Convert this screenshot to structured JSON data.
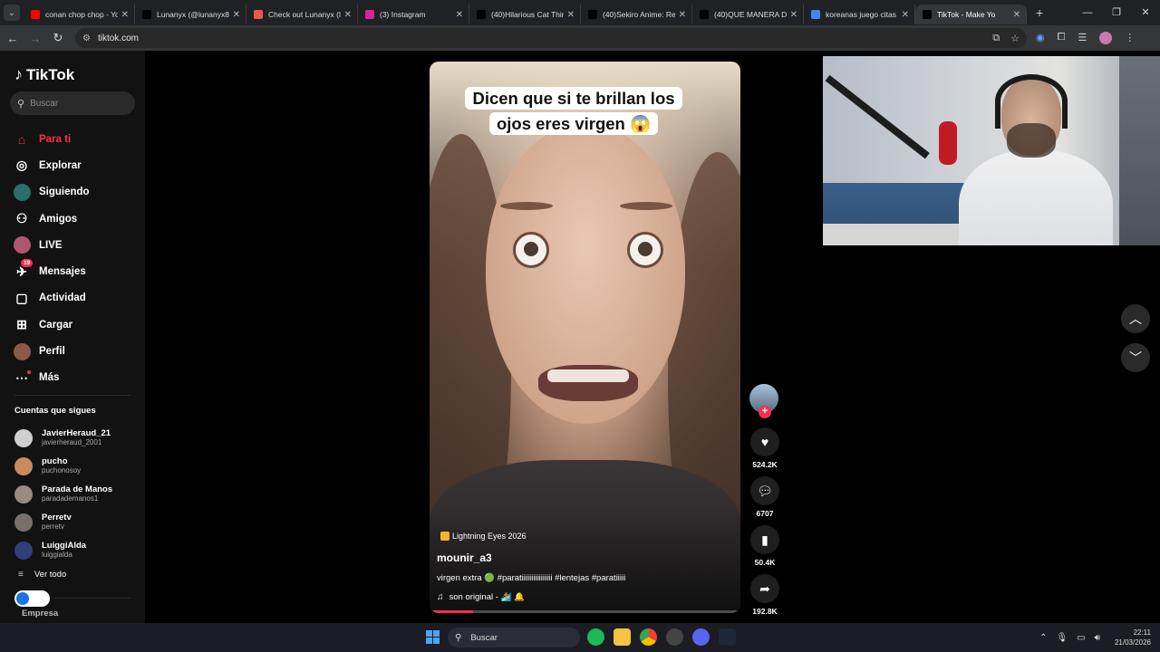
{
  "browser": {
    "tabs": [
      {
        "title": "conan chop chop - Yo",
        "favicon_color": "#ff0000",
        "favicon": "yt-icon",
        "active": false
      },
      {
        "title": "Lunanyx (@lunanyx8",
        "favicon_color": "#000000",
        "favicon": "tiktok-icon",
        "active": false
      },
      {
        "title": "Check out Lunanyx (l",
        "favicon_color": "#e8594a",
        "favicon": "page-icon",
        "active": false
      },
      {
        "title": "(3) Instagram",
        "favicon_color": "#d6249f",
        "favicon": "instagram-icon",
        "active": false
      },
      {
        "title": "(40)Hilarious Cat Thin",
        "favicon_color": "#000000",
        "favicon": "tiktok-icon",
        "active": false
      },
      {
        "title": "(40)Sekiro Anime: Re",
        "favicon_color": "#000000",
        "favicon": "tiktok-icon",
        "active": false
      },
      {
        "title": "(40)QUE MANERA DE",
        "favicon_color": "#000000",
        "favicon": "tiktok-icon",
        "active": false
      },
      {
        "title": "koreanas juego citas",
        "favicon_color": "#4285f4",
        "favicon": "google-icon",
        "active": false
      },
      {
        "title": "TikTok - Make Yo",
        "favicon_color": "#000000",
        "favicon": "tiktok-icon",
        "active": true
      }
    ],
    "url": "tiktok.com"
  },
  "sidebar": {
    "logo": "TikTok",
    "search_placeholder": "Buscar",
    "nav": [
      {
        "label": "Para ti",
        "icon": "home-icon",
        "active": true
      },
      {
        "label": "Explorar",
        "icon": "compass-icon",
        "active": false
      },
      {
        "label": "Siguiendo",
        "icon": "following-avatar-icon",
        "active": false
      },
      {
        "label": "Amigos",
        "icon": "friends-icon",
        "active": false
      },
      {
        "label": "LIVE",
        "icon": "live-avatar-icon",
        "active": false
      },
      {
        "label": "Mensajes",
        "icon": "messages-icon",
        "active": false,
        "badge": "19"
      },
      {
        "label": "Actividad",
        "icon": "activity-icon",
        "active": false
      },
      {
        "label": "Cargar",
        "icon": "upload-icon",
        "active": false
      },
      {
        "label": "Perfil",
        "icon": "profile-avatar-icon",
        "active": false
      },
      {
        "label": "Más",
        "icon": "more-icon",
        "active": false
      }
    ],
    "following_title": "Cuentas que sigues",
    "following": [
      {
        "name": "JavierHeraud_21",
        "handle": "javierheraud_2001",
        "color": "#cfcfcf"
      },
      {
        "name": "pucho",
        "handle": "puchonosoy",
        "color": "#c98a5e"
      },
      {
        "name": "Parada de Manos",
        "handle": "paradademanos1",
        "color": "#9a8a80"
      },
      {
        "name": "Perretv",
        "handle": "perretv",
        "color": "#7a6f6a"
      },
      {
        "name": "LuiggiAlda",
        "handle": "luiggialda",
        "color": "#2f3f7a"
      }
    ],
    "see_all": "Ver todo",
    "empresa": "Empresa"
  },
  "video": {
    "caption_text": "Dicen que si te brillan los ojos eres virgen 😱",
    "effect": "Lightning Eyes 2026",
    "author": "mounir_a3",
    "description": "virgen extra 🟢 #paratiiiiiiiiiiiiiiii #lentejas #paratiiiii",
    "sound": "son original - 🏄 🔔",
    "progress_fraction": 0.14
  },
  "actions": {
    "likes": "524.2K",
    "comments": "6707",
    "saves": "50.4K",
    "shares": "192.8K"
  },
  "taskbar": {
    "search": "Buscar",
    "time": "22:11",
    "date": "21/03/2026"
  }
}
